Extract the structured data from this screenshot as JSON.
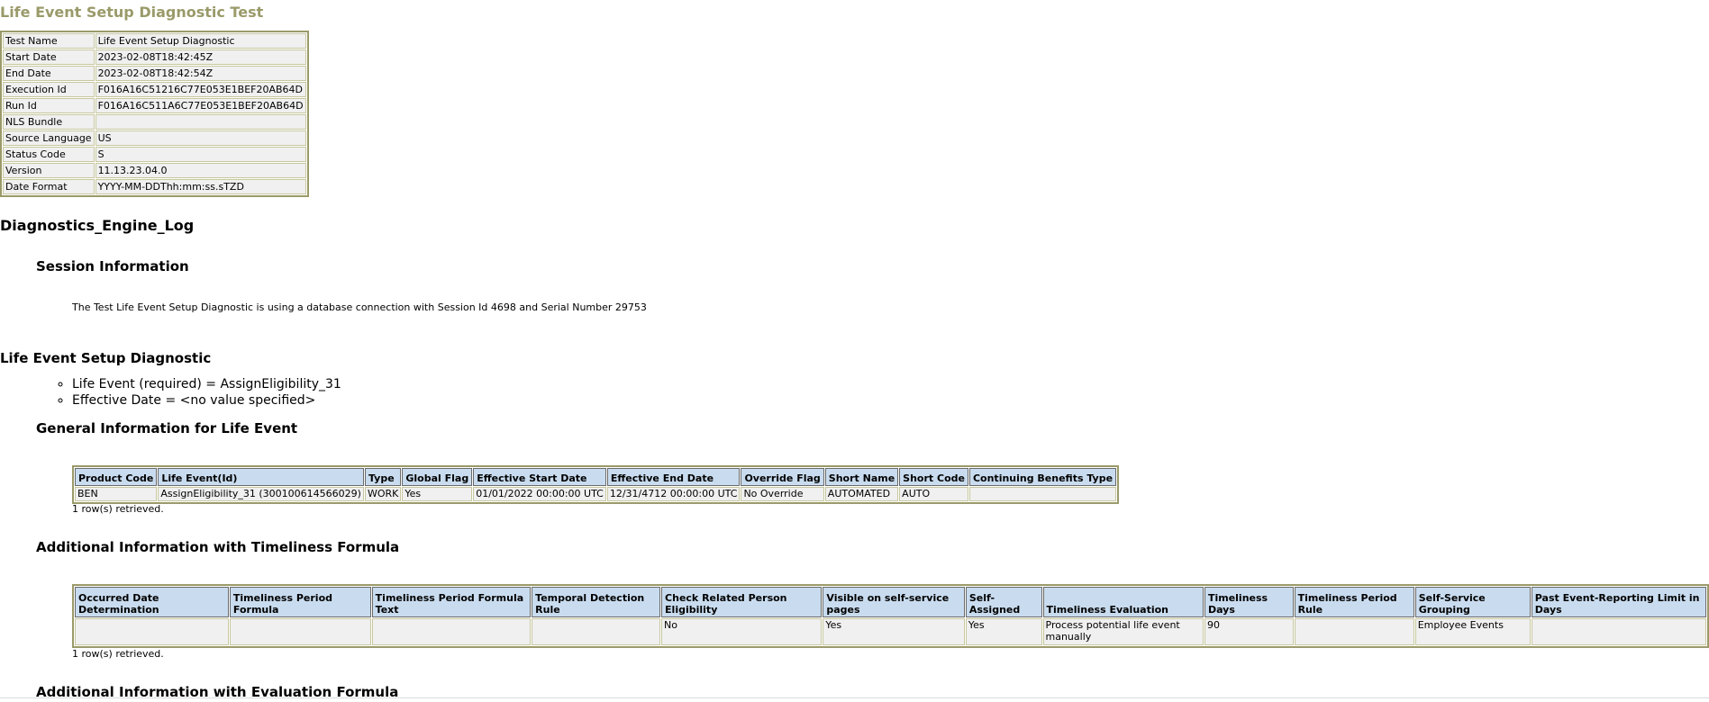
{
  "page": {
    "title": "Life Event Setup Diagnostic Test"
  },
  "meta": {
    "rows": [
      {
        "key": "Test Name",
        "value": "Life Event Setup Diagnostic"
      },
      {
        "key": "Start Date",
        "value": "2023-02-08T18:42:45Z"
      },
      {
        "key": "End Date",
        "value": "2023-02-08T18:42:54Z"
      },
      {
        "key": "Execution Id",
        "value": "F016A16C51216C77E053E1BEF20AB64D"
      },
      {
        "key": "Run Id",
        "value": "F016A16C511A6C77E053E1BEF20AB64D"
      },
      {
        "key": "NLS Bundle",
        "value": ""
      },
      {
        "key": "Source Language",
        "value": "US"
      },
      {
        "key": "Status Code",
        "value": "S"
      },
      {
        "key": "Version",
        "value": "11.13.23.04.0"
      },
      {
        "key": "Date Format",
        "value": "YYYY-MM-DDThh:mm:ss.sTZD"
      }
    ]
  },
  "log": {
    "heading": "Diagnostics_Engine_Log",
    "session_heading": "Session Information",
    "session_text": "The Test Life Event Setup Diagnostic is using a database connection with Session Id 4698 and Serial Number 29753"
  },
  "diagnostic": {
    "heading": "Life Event Setup Diagnostic",
    "params": [
      "Life Event (required) = AssignEligibility_31",
      "Effective Date = <no value specified>"
    ]
  },
  "general": {
    "heading": "General Information for Life Event",
    "headers": [
      "Product Code",
      "Life Event(Id)",
      "Type",
      "Global Flag",
      "Effective Start Date",
      "Effective End Date",
      "Override Flag",
      "Short Name",
      "Short Code",
      "Continuing Benefits Type"
    ],
    "rows": [
      [
        "BEN",
        "AssignEligibility_31 (300100614566029)",
        "WORK",
        "Yes",
        "01/01/2022 00:00:00 UTC",
        "12/31/4712 00:00:00 UTC",
        "No Override",
        "AUTOMATED",
        "AUTO",
        ""
      ]
    ],
    "footer": "1 row(s) retrieved."
  },
  "timeliness": {
    "heading": "Additional Information with Timeliness Formula",
    "headers": [
      "Occurred Date Determination",
      "Timeliness Period Formula",
      "Timeliness Period Formula Text",
      "Temporal Detection Rule",
      "Check Related Person Eligibility",
      "Visible on self-service pages",
      "Self-Assigned",
      "Timeliness Evaluation",
      "Timeliness Days",
      "Timeliness Period Rule",
      "Self-Service Grouping",
      "Past Event-Reporting Limit in Days"
    ],
    "rows": [
      [
        "",
        "",
        "",
        "",
        "No",
        "Yes",
        "Yes",
        "Process potential life event manually",
        "90",
        "",
        "Employee Events",
        ""
      ]
    ],
    "footer": "1 row(s) retrieved."
  },
  "evaluation": {
    "heading": "Additional Information with Evaluation Formula"
  }
}
